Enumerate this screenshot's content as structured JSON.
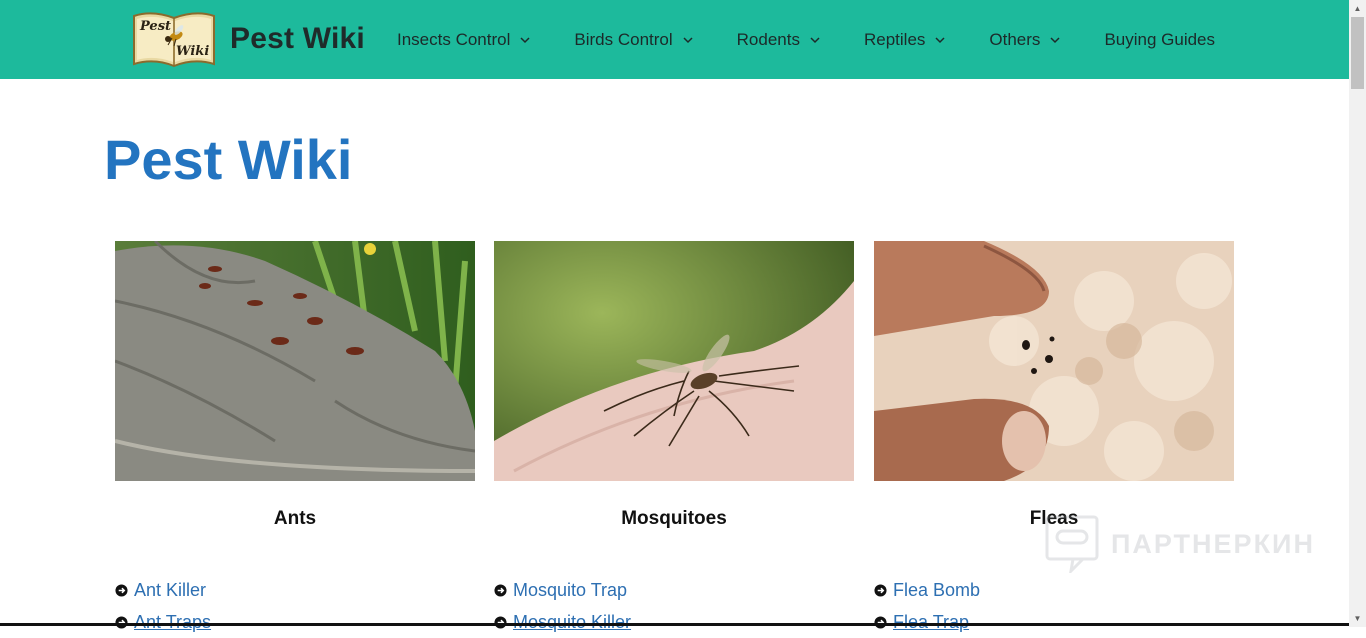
{
  "site": {
    "title": "Pest Wiki",
    "logo_text_top": "Pest",
    "logo_text_bottom": "Wiki"
  },
  "nav": [
    {
      "label": "Insects Control",
      "has_dropdown": true
    },
    {
      "label": "Birds Control",
      "has_dropdown": true
    },
    {
      "label": "Rodents",
      "has_dropdown": true
    },
    {
      "label": "Reptiles",
      "has_dropdown": true
    },
    {
      "label": "Others",
      "has_dropdown": true
    },
    {
      "label": "Buying Guides",
      "has_dropdown": false
    }
  ],
  "page": {
    "heading": "Pest Wiki"
  },
  "cards": [
    {
      "name": "Ants",
      "image": "ants-on-log",
      "links": [
        "Ant Killer",
        "Ant Traps"
      ]
    },
    {
      "name": "Mosquitoes",
      "image": "mosquito-on-skin",
      "links": [
        "Mosquito Trap",
        "Mosquito Killer"
      ]
    },
    {
      "name": "Fleas",
      "image": "fleas-in-fur",
      "links": [
        "Flea Bomb",
        "Flea Trap"
      ]
    }
  ],
  "watermark": "ПАРТНЕРКИН",
  "colors": {
    "header_bg": "#1dba9c",
    "heading": "#2374c0",
    "link": "#2d6fb2"
  }
}
